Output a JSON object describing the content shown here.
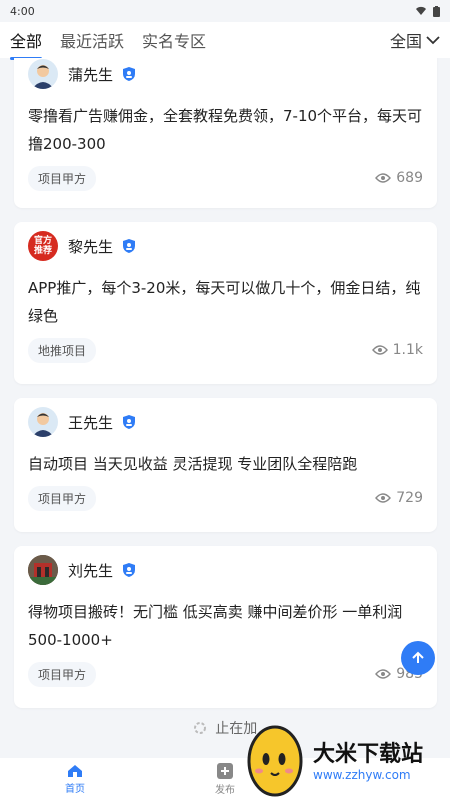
{
  "status_bar": {
    "time": "4:00"
  },
  "tabs": {
    "items": [
      {
        "label": "全部",
        "active": true
      },
      {
        "label": "最近活跃",
        "active": false
      },
      {
        "label": "实名专区",
        "active": false
      }
    ],
    "region": "全国"
  },
  "posts": [
    {
      "user": "蒲先生",
      "content": "零撸看广告赚佣金，全套教程免费领，7-10个平台，每天可撸200-300",
      "tag": "项目甲方",
      "views": "689"
    },
    {
      "user": "黎先生",
      "avatar_text": "官方推荐",
      "content": "APP推广，每个3-20米，每天可以做几十个，佣金日结，纯绿色",
      "tag": "地推项目",
      "views": "1.1k"
    },
    {
      "user": "王先生",
      "content": "自动项目 当天见收益 灵活提现 专业团队全程陪跑",
      "tag": "项目甲方",
      "views": "729"
    },
    {
      "user": "刘先生",
      "content": "得物项目搬砖！无门槛 低买高卖 赚中间差价形 一单利润500-1000+",
      "tag": "项目甲方",
      "views": "985"
    }
  ],
  "loading": "止在加",
  "bottom_nav": [
    {
      "label": "首页",
      "active": true
    },
    {
      "label": "发布",
      "active": false
    }
  ],
  "watermark": {
    "title": "大米下载站",
    "url": "www.zzhyw.com"
  },
  "colors": {
    "accent": "#2f7cf6",
    "background": "#f3f5f8"
  }
}
